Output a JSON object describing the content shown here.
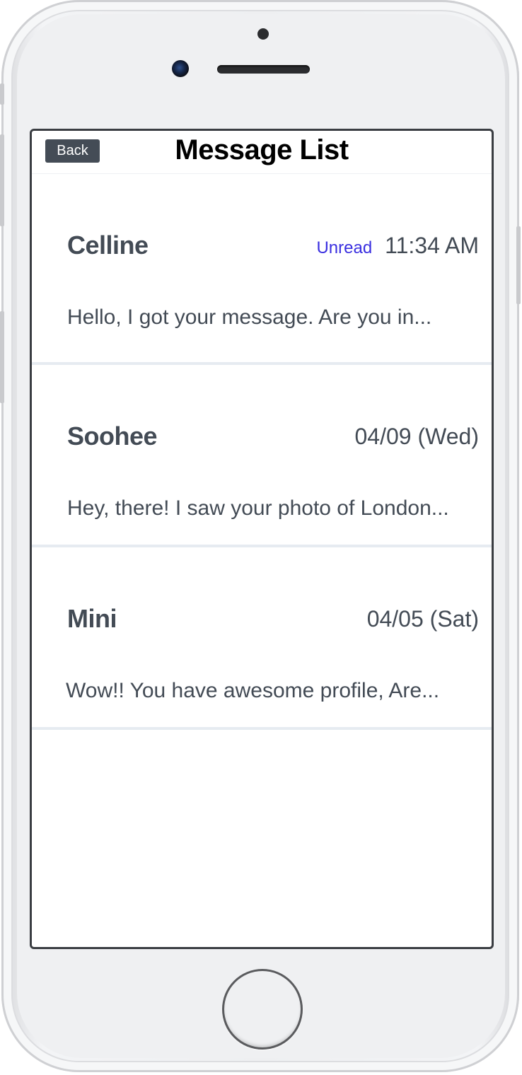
{
  "header": {
    "back_label": "Back",
    "title": "Message List"
  },
  "messages": [
    {
      "name": "Celline",
      "status": "Unread",
      "time": "11:34 AM",
      "preview": "Hello, I got your message. Are you in..."
    },
    {
      "name": "Soohee",
      "time": "04/09 (Wed)",
      "preview": "Hey, there! I saw your photo of London..."
    },
    {
      "name": "Mini",
      "time": "04/05 (Sat)",
      "preview": "Wow!! You have awesome profile, Are..."
    }
  ],
  "colors": {
    "unread_accent": "#3a2fe0",
    "text": "#434b55",
    "back_button_bg": "#444c56",
    "divider": "#e6ebf1"
  },
  "icons": [
    "front-camera-icon",
    "home-button-icon"
  ]
}
